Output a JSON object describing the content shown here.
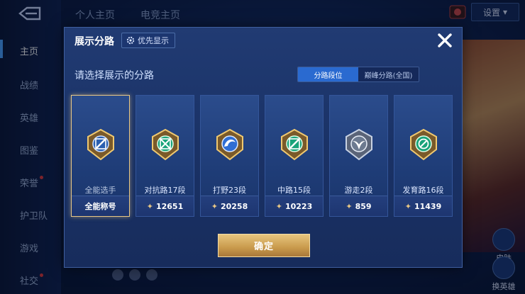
{
  "nav": {
    "items": [
      {
        "label": "主页",
        "active": true
      },
      {
        "label": "战绩"
      },
      {
        "label": "英雄"
      },
      {
        "label": "图鉴"
      },
      {
        "label": "荣誉",
        "dot": true
      },
      {
        "label": "护卫队"
      },
      {
        "label": "游戏"
      },
      {
        "label": "社交",
        "dot": true
      }
    ]
  },
  "top": {
    "tabs": [
      "个人主页",
      "电竞主页"
    ],
    "settings_label": "设置"
  },
  "side_buttons": {
    "skin_label": "皮肤",
    "change_hero_label": "换英雄"
  },
  "modal": {
    "title": "展示分路",
    "priority_label": "优先显示",
    "subtitle": "请选择展示的分路",
    "segment": {
      "left": "分路段位",
      "right": "巅峰分路(全国)"
    },
    "confirm_label": "确定",
    "cards": [
      {
        "label": "全能选手",
        "score": "全能称号",
        "icon": "all-round-icon",
        "selected": true
      },
      {
        "label": "对抗路17段",
        "score": "12651",
        "icon": "clash-lane-icon"
      },
      {
        "label": "打野23段",
        "score": "20258",
        "icon": "jungle-icon"
      },
      {
        "label": "中路15段",
        "score": "10223",
        "icon": "mid-lane-icon"
      },
      {
        "label": "游走2段",
        "score": "859",
        "icon": "roam-icon"
      },
      {
        "label": "发育路16段",
        "score": "11439",
        "icon": "farm-lane-icon"
      }
    ]
  },
  "colors": {
    "accent": "#2a6ad0",
    "gold": "#e8c785",
    "panel": "#1a3266"
  }
}
